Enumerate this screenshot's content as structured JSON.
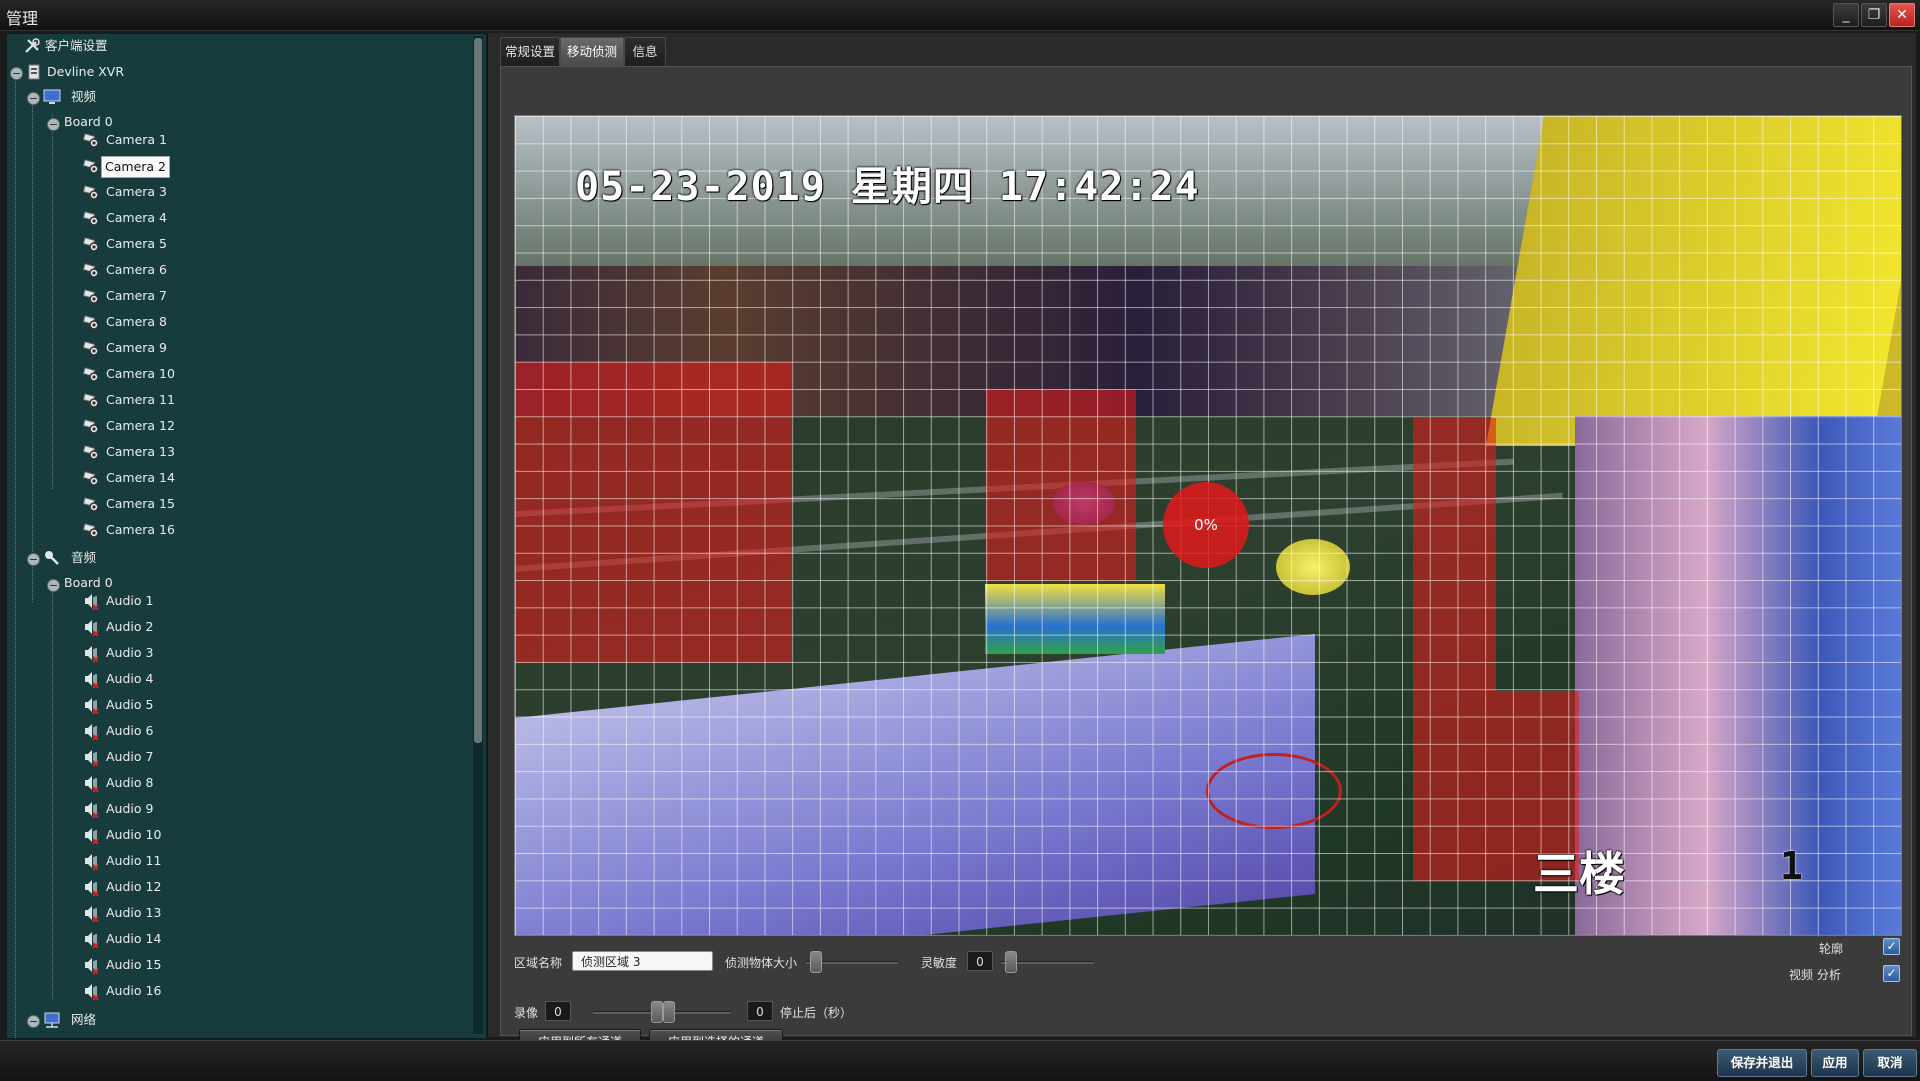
{
  "window": {
    "title": "管理",
    "minimize": "_",
    "maximize": "❐",
    "close": "✕"
  },
  "tree": {
    "client_settings": "客户端设置",
    "device": "Devline XVR",
    "video": "视频",
    "video_board": "Board 0",
    "cameras": [
      "Camera 1",
      "Camera 2",
      "Camera 3",
      "Camera 4",
      "Camera 5",
      "Camera 6",
      "Camera 7",
      "Camera 8",
      "Camera 9",
      "Camera 10",
      "Camera 11",
      "Camera 12",
      "Camera 13",
      "Camera 14",
      "Camera 15",
      "Camera 16"
    ],
    "selected_camera": "Camera 2",
    "audio": "音频",
    "audio_board": "Board 0",
    "audios": [
      "Audio 1",
      "Audio 2",
      "Audio 3",
      "Audio 4",
      "Audio 5",
      "Audio 6",
      "Audio 7",
      "Audio 8",
      "Audio 9",
      "Audio 10",
      "Audio 11",
      "Audio 12",
      "Audio 13",
      "Audio 14",
      "Audio 15",
      "Audio 16"
    ],
    "network": "网络"
  },
  "tabs": [
    {
      "label": "常规设置",
      "active": false
    },
    {
      "label": "移动侦测",
      "active": true
    },
    {
      "label": "信息",
      "active": false
    }
  ],
  "video": {
    "osd_datetime": "05-23-2019 星期四 17:42:24",
    "osd_location": "三楼",
    "osd_channel": "1",
    "motion_percent": "0%"
  },
  "controls": {
    "zone_name_label": "区域名称",
    "zone_name_value": "侦测区域 3",
    "object_size_label": "侦测物体大小",
    "sensitivity_label": "灵敏度",
    "sensitivity_value": "0",
    "record_label": "录像",
    "record_value": "0",
    "stop_after_value": "0",
    "stop_after_label": "停止后（秒）",
    "apply_all_label": "应用到所有通道",
    "apply_selected_label": "应用到选择的通道",
    "outline_label": "轮廓",
    "outline_checked": true,
    "video_analysis_label": "视频 分析",
    "video_analysis_checked": true
  },
  "footer": {
    "save_exit": "保存并退出",
    "apply": "应用",
    "cancel": "取消"
  },
  "colors": {
    "sidebar_bg": "#183c3e",
    "motion_mask": "#e01c1c",
    "accent_button": "#2b4a66"
  }
}
